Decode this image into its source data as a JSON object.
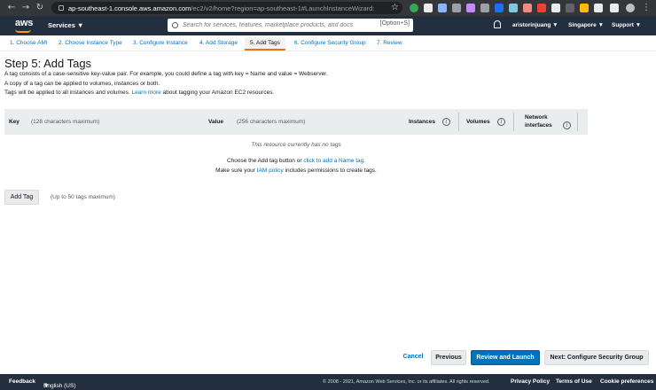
{
  "browser": {
    "url_host": "ap-southeast-1.console.aws.amazon.com",
    "url_path": "/ec2/v2/home?region=ap-southeast-1#LaunchInstanceWizard:"
  },
  "aws_header": {
    "logo_text": "aws",
    "services_label": "Services",
    "search_placeholder": "Search for services, features, marketplace products, and docs",
    "search_shortcut": "[Option+S]",
    "user": "aristorinjuang",
    "region": "Singapore",
    "support": "Support"
  },
  "wizard_steps": [
    {
      "label": "1. Choose AMI",
      "active": false
    },
    {
      "label": "2. Choose Instance Type",
      "active": false
    },
    {
      "label": "3. Configure Instance",
      "active": false
    },
    {
      "label": "4. Add Storage",
      "active": false
    },
    {
      "label": "5. Add Tags",
      "active": true
    },
    {
      "label": "6. Configure Security Group",
      "active": false
    },
    {
      "label": "7. Review",
      "active": false
    }
  ],
  "page": {
    "title": "Step 5: Add Tags",
    "desc1": "A tag consists of a case-sensitive key-value pair. For example, you could define a tag with key = Name and value = Webserver.",
    "desc2": "A copy of a tag can be applied to volumes, instances or both.",
    "desc3_before": "Tags will be applied to all instances and volumes. ",
    "desc3_link": "Learn more",
    "desc3_after": " about tagging your Amazon EC2 resources."
  },
  "table": {
    "col_key": "Key",
    "col_key_hint": "(128 characters maximum)",
    "col_value": "Value",
    "col_value_hint": "(256 characters maximum)",
    "col_instances": "Instances",
    "col_volumes": "Volumes",
    "col_network_line1": "Network",
    "col_network_line2": "interfaces",
    "info_glyph": "i",
    "empty_message": "This resource currently has no tags",
    "choose_before": "Choose the Add tag button or ",
    "choose_link": "click to add a Name tag",
    "choose_after": ".",
    "iam_before": "Make sure your ",
    "iam_link": "IAM policy",
    "iam_after": " includes permissions to create tags."
  },
  "add_tag": {
    "button_label": "Add Tag",
    "hint": "(Up to 50 tags maximum)"
  },
  "actions": {
    "cancel": "Cancel",
    "previous": "Previous",
    "review_launch": "Review and Launch",
    "next": "Next: Configure Security Group"
  },
  "footer": {
    "feedback": "Feedback",
    "language": "English (US)",
    "copyright": "© 2008 - 2021, Amazon Web Services, Inc. or its affiliates. All rights reserved.",
    "privacy": "Privacy Policy",
    "terms": "Terms of Use",
    "cookies": "Cookie preferences"
  },
  "colors": {
    "aws_nav": "#232f3e",
    "link_blue": "#0073bb",
    "active_step_underline": "#ec7211"
  }
}
